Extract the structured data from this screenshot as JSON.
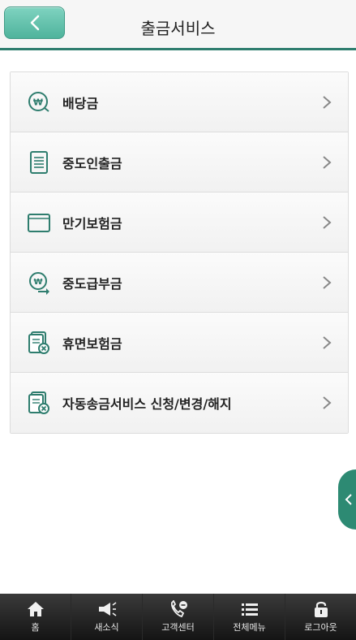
{
  "header": {
    "title": "출금서비스",
    "back_label": "<"
  },
  "menu": {
    "items": [
      {
        "label": "배당금",
        "icon": "won-circle-icon"
      },
      {
        "label": "중도인출금",
        "icon": "document-list-icon"
      },
      {
        "label": "만기보험금",
        "icon": "folder-icon"
      },
      {
        "label": "중도급부금",
        "icon": "won-arrow-icon"
      },
      {
        "label": "휴면보험금",
        "icon": "document-cancel-icon"
      },
      {
        "label": "자동송금서비스 신청/변경/해지",
        "icon": "document-cancel-icon"
      }
    ]
  },
  "tabbar": {
    "items": [
      {
        "label": "홈",
        "icon": "home-icon"
      },
      {
        "label": "새소식",
        "icon": "megaphone-icon"
      },
      {
        "label": "고객센터",
        "icon": "phone-icon"
      },
      {
        "label": "전체메뉴",
        "icon": "menu-list-icon"
      },
      {
        "label": "로그아웃",
        "icon": "lock-icon"
      }
    ]
  },
  "colors": {
    "accent": "#2e7d6e",
    "back_button": "#5fc2aa",
    "side_tab": "#2d8a73"
  }
}
